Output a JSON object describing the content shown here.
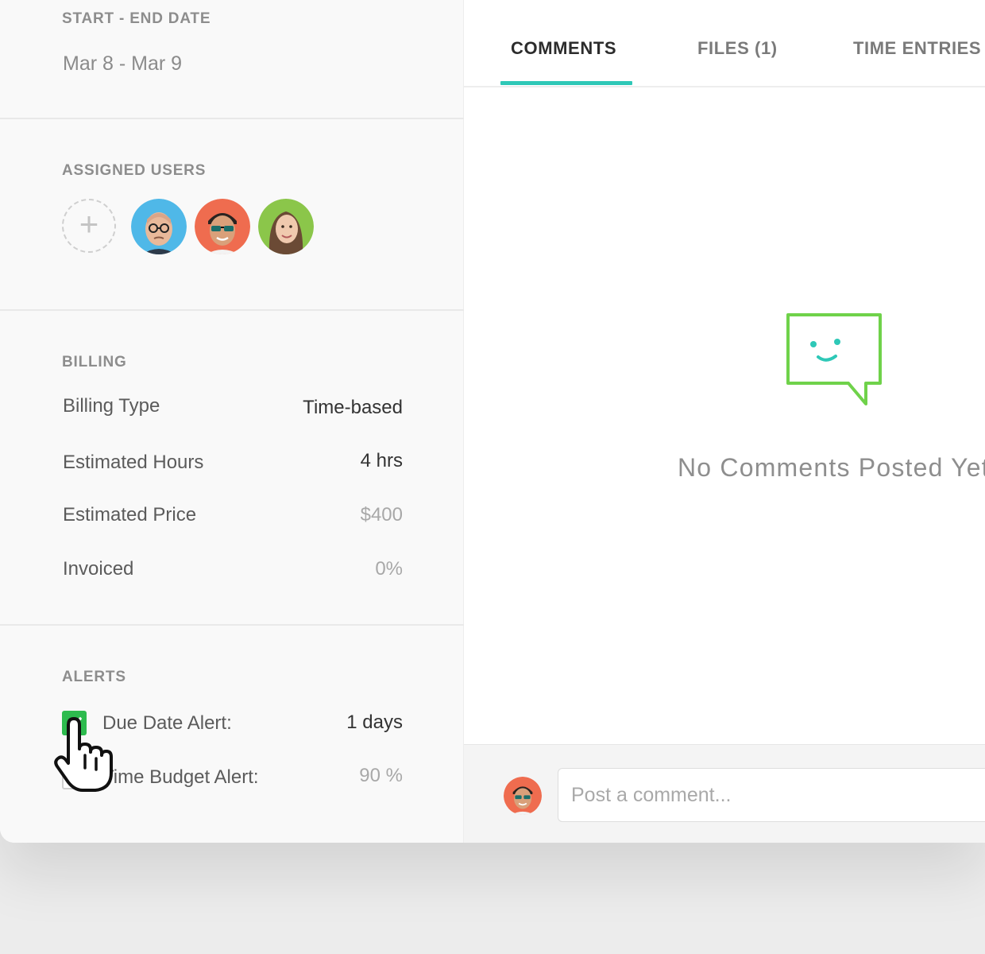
{
  "left_panel": {
    "dates": {
      "label": "START - END DATE",
      "value": "Mar 8 - Mar 9"
    },
    "assigned": {
      "label": "ASSIGNED USERS",
      "add_symbol": "+"
    },
    "billing": {
      "label": "BILLING",
      "rows": [
        {
          "label": "Billing Type",
          "value": "Time-based"
        },
        {
          "label": "Estimated Hours",
          "value": "4 hrs"
        },
        {
          "label": "Estimated Price",
          "value": "$400"
        },
        {
          "label": "Invoiced",
          "value": "0%"
        }
      ]
    },
    "alerts": {
      "label": "ALERTS",
      "rows": [
        {
          "label": "Due Date Alert:",
          "value": "1 days",
          "checked": true
        },
        {
          "label": "Time Budget Alert:",
          "value": "90 %",
          "checked": false
        }
      ]
    }
  },
  "tabs": {
    "items": [
      {
        "label": "COMMENTS",
        "active": true
      },
      {
        "label": "FILES (1)",
        "active": false
      },
      {
        "label": "TIME ENTRIES",
        "active": false
      }
    ]
  },
  "empty_state": {
    "message": "No Comments Posted Yet",
    "icon": "chat-bubble-smiley-icon"
  },
  "comment_box": {
    "placeholder": "Post a comment..."
  },
  "colors": {
    "accent_teal": "#2ec8b7",
    "checkbox_green": "#2dbb4e",
    "icon_green": "#6fd24a",
    "avatar_blue": "#4fb8e8",
    "avatar_red": "#ef6c4f",
    "avatar_green": "#8bc64a"
  }
}
